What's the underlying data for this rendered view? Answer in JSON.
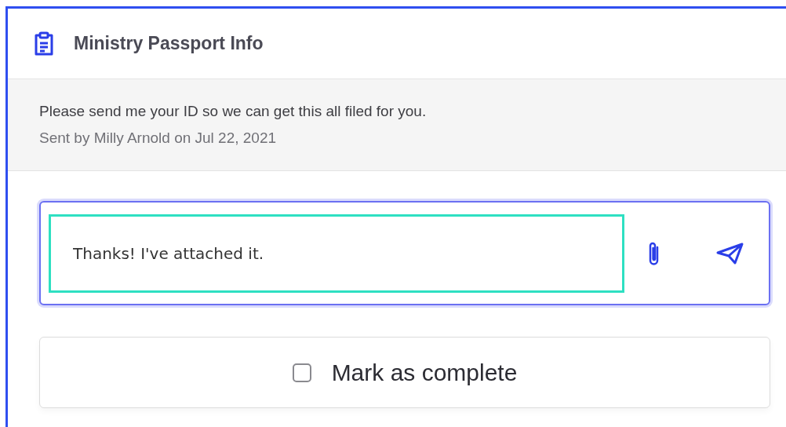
{
  "header": {
    "title": "Ministry Passport Info"
  },
  "message": {
    "text": "Please send me your ID so we can get this all filed for you.",
    "meta": "Sent by Milly Arnold on Jul 22, 2021"
  },
  "composer": {
    "value": "Thanks! I've attached it.",
    "focused": true
  },
  "mark_complete": {
    "label": "Mark as complete",
    "checked": false
  }
}
